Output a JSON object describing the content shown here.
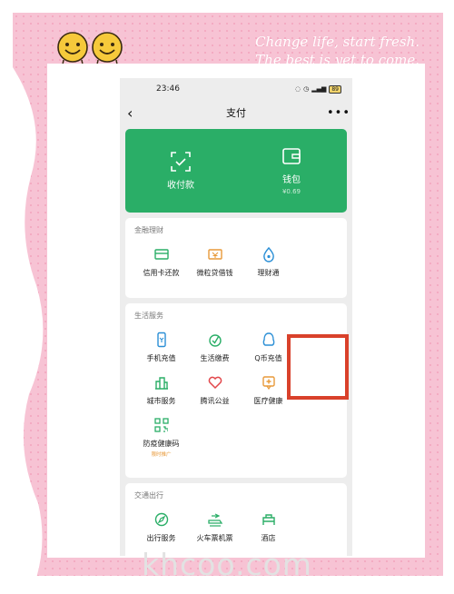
{
  "decor": {
    "slogan_line1": "Change life, start fresh.",
    "slogan_line2": "The best is yet to come.",
    "watermark": "khcoo.com"
  },
  "status": {
    "time": "23:46",
    "battery": "89"
  },
  "nav": {
    "title": "支付",
    "back_icon": "chevron-left-icon",
    "more_icon": "more-icon"
  },
  "top": {
    "items": [
      {
        "label": "收付款",
        "icon": "scan-icon"
      },
      {
        "label": "钱包",
        "sub": "¥0.69",
        "icon": "wallet-icon"
      }
    ]
  },
  "finance": {
    "title": "金融理财",
    "items": [
      {
        "label": "信用卡还款"
      },
      {
        "label": "微粒贷借钱"
      },
      {
        "label": "理财通"
      }
    ]
  },
  "life": {
    "title": "生活服务",
    "items": [
      {
        "label": "手机充值"
      },
      {
        "label": "生活缴费"
      },
      {
        "label": "Q币充值"
      },
      {
        "label": "城市服务"
      },
      {
        "label": "腾讯公益"
      },
      {
        "label": "医疗健康"
      },
      {
        "label": "防疫健康码",
        "tag": "限时推广"
      }
    ]
  },
  "travel": {
    "title": "交通出行",
    "items": [
      {
        "label": "出行服务"
      },
      {
        "label": "火车票机票"
      },
      {
        "label": "酒店"
      }
    ]
  },
  "colors": {
    "wechat_green": "#2aae67",
    "highlight_red": "#d9412b",
    "frame_pink": "#f7c3d4"
  }
}
